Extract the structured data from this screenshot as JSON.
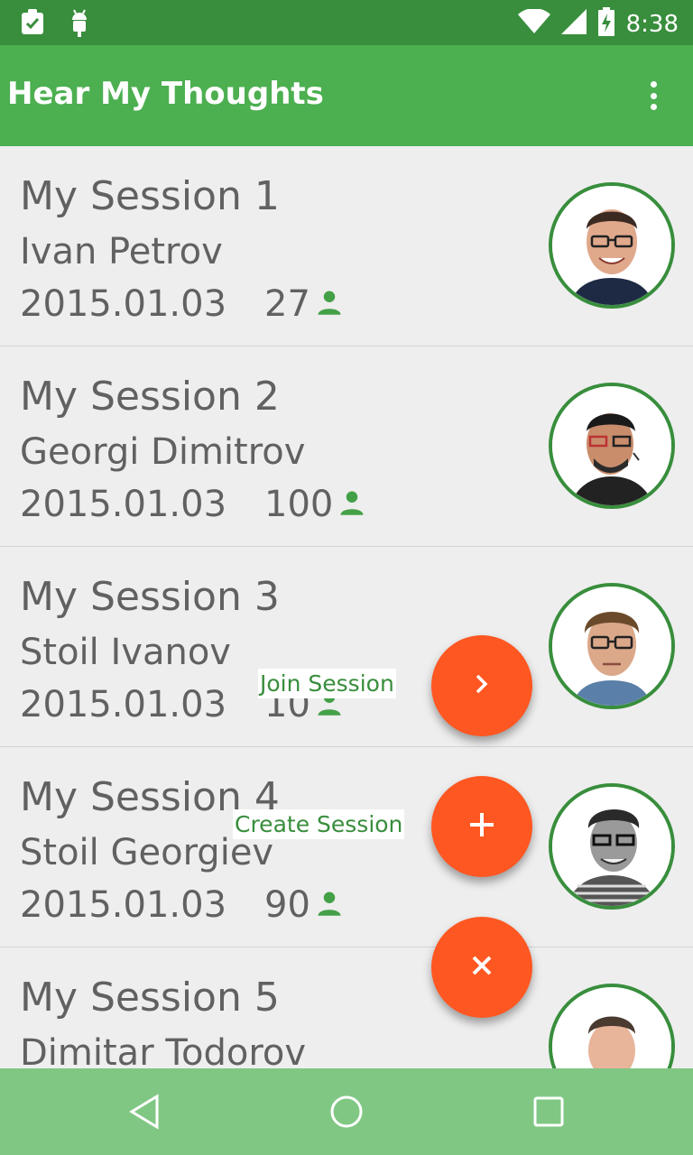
{
  "status_bar": {
    "time": "8:38",
    "icons": [
      "clipboard-check-icon",
      "android-debug-icon",
      "wifi-icon",
      "cell-signal-icon",
      "battery-charging-icon"
    ]
  },
  "app_bar": {
    "title": "Hear My Thoughts",
    "menu_icon": "overflow-menu-icon"
  },
  "sessions": [
    {
      "title": "My Session 1",
      "speaker": "Ivan Petrov",
      "date": "2015.01.03",
      "count": "27"
    },
    {
      "title": "My Session 2",
      "speaker": "Georgi Dimitrov",
      "date": "2015.01.03",
      "count": "100"
    },
    {
      "title": "My Session 3",
      "speaker": "Stoil Ivanov",
      "date": "2015.01.03",
      "count": "10"
    },
    {
      "title": "My Session 4",
      "speaker": "Stoil Georgiev",
      "date": "2015.01.03",
      "count": "90"
    },
    {
      "title": "My Session 5",
      "speaker": "Dimitar Todorov",
      "date": "",
      "count": ""
    }
  ],
  "fab_menu": {
    "join_label": "Join Session",
    "create_label": "Create Session",
    "join_icon": "chevron-right-icon",
    "create_icon": "plus-icon",
    "close_icon": "close-icon"
  },
  "colors": {
    "status_bar": "#388e3c",
    "app_bar": "#4caf50",
    "nav_bar": "#81c784",
    "accent": "#ff5722",
    "text": "#616161",
    "icon_green": "#43a047"
  },
  "nav_bar": {
    "icons": [
      "back-icon",
      "home-icon",
      "recents-icon"
    ]
  }
}
